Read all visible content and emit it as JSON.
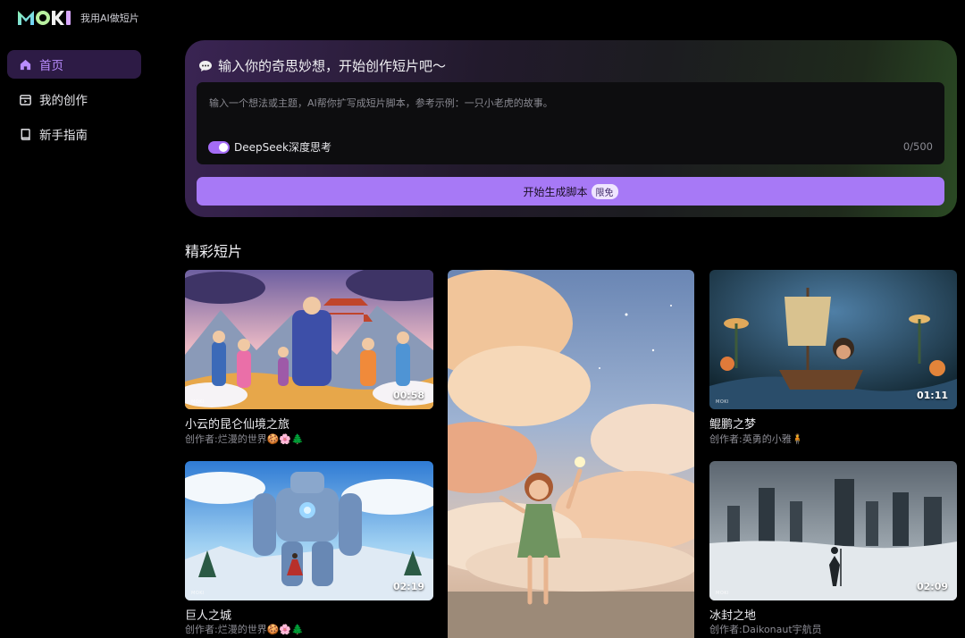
{
  "brand": {
    "tagline": "我用AI做短片"
  },
  "nav": {
    "items": [
      {
        "label": "首页",
        "icon": "home-icon",
        "active": true
      },
      {
        "label": "我的创作",
        "icon": "creations-icon",
        "active": false
      },
      {
        "label": "新手指南",
        "icon": "guide-book-icon",
        "active": false
      }
    ]
  },
  "prompt": {
    "heading": "输入你的奇思妙想，开始创作短片吧～",
    "placeholder": "输入一个想法或主题，AI帮你扩写成短片脚本，参考示例：一只小老虎的故事。",
    "deepseek_label": "DeepSeek深度思考",
    "deepseek_on": true,
    "counter": "0/500",
    "generate_label": "开始生成脚本",
    "free_badge": "限免"
  },
  "section": {
    "title": "精彩短片"
  },
  "videos": [
    {
      "title": "小云的昆仑仙境之旅",
      "author": "创作者:烂漫的世界🍪🌸🌲",
      "duration": "00:58"
    },
    {
      "title": "",
      "author": "",
      "duration": ""
    },
    {
      "title": "鲲鹏之梦",
      "author": "创作者:英勇的小雅🧍",
      "duration": "01:11"
    },
    {
      "title": "巨人之城",
      "author": "创作者:烂漫的世界🍪🌸🌲",
      "duration": "02:19"
    },
    {
      "title": "冰封之地",
      "author": "创作者:Daikonaut宇航员",
      "duration": "02:09"
    }
  ],
  "colors": {
    "accent": "#a779f6",
    "nav_active_bg": "#2d1b45",
    "nav_active_text": "#b98cff"
  }
}
